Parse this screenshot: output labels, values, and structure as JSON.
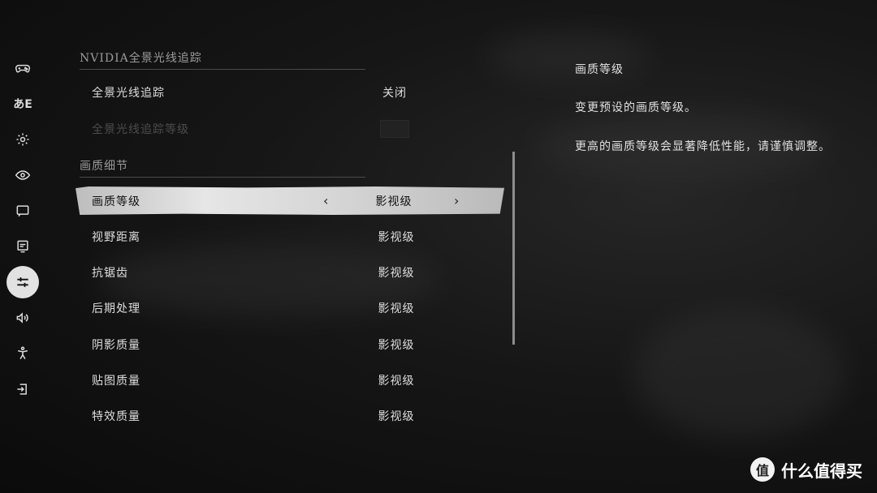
{
  "nav": {
    "items": [
      {
        "icon": "gamepad-icon"
      },
      {
        "icon": "language-icon",
        "label": "あE"
      },
      {
        "icon": "gear-icon"
      },
      {
        "icon": "eye-icon"
      },
      {
        "icon": "chat-icon"
      },
      {
        "icon": "monitor-icon"
      },
      {
        "icon": "sliders-icon",
        "active": true
      },
      {
        "icon": "speaker-icon"
      },
      {
        "icon": "accessibility-icon"
      },
      {
        "icon": "exit-icon"
      }
    ]
  },
  "sections": {
    "raytracing_header": "NVIDIA全景光线追踪",
    "quality_header": "画质细节"
  },
  "settings": {
    "raytracing": {
      "label": "全景光线追踪",
      "value": "关闭"
    },
    "raytracing_level": {
      "label": "全景光线追踪等级"
    },
    "quality_level": {
      "label": "画质等级",
      "value": "影视级",
      "prev": "‹",
      "next": "›"
    },
    "view_distance": {
      "label": "视野距离",
      "value": "影视级"
    },
    "antialiasing": {
      "label": "抗锯齿",
      "value": "影视级"
    },
    "post_processing": {
      "label": "后期处理",
      "value": "影视级"
    },
    "shadow_quality": {
      "label": "阴影质量",
      "value": "影视级"
    },
    "texture_quality": {
      "label": "贴图质量",
      "value": "影视级"
    },
    "effects_quality": {
      "label": "特效质量",
      "value": "影视级"
    }
  },
  "description": {
    "title": "画质等级",
    "line1": "变更预设的画质等级。",
    "line2": "更高的画质等级会显著降低性能，请谨慎调整。"
  },
  "watermark": {
    "logo": "值",
    "text": "什么值得买"
  }
}
